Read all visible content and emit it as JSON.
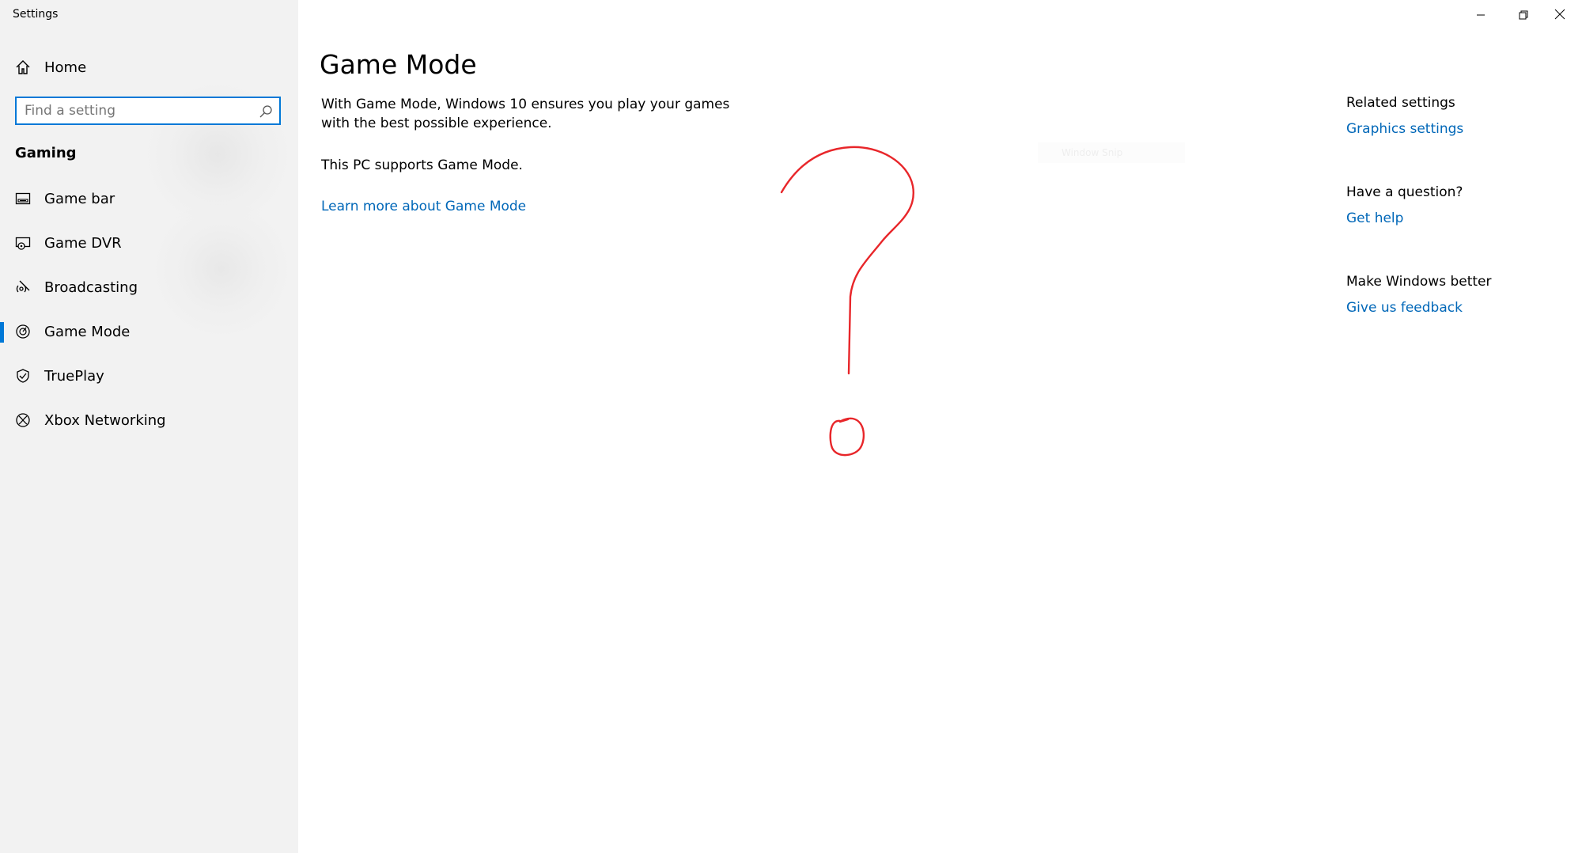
{
  "window": {
    "title": "Settings",
    "minimize_icon": "minimize-icon",
    "restore_icon": "restore-icon",
    "close_icon": "close-icon"
  },
  "sidebar": {
    "home_label": "Home",
    "home_icon": "home-icon",
    "search": {
      "placeholder": "Find a setting",
      "value": "",
      "icon": "search-icon"
    },
    "section_heading": "Gaming",
    "items": [
      {
        "label": "Game bar",
        "icon": "game-bar-icon",
        "selected": false
      },
      {
        "label": "Game DVR",
        "icon": "game-dvr-icon",
        "selected": false
      },
      {
        "label": "Broadcasting",
        "icon": "broadcasting-icon",
        "selected": false
      },
      {
        "label": "Game Mode",
        "icon": "game-mode-icon",
        "selected": true
      },
      {
        "label": "TruePlay",
        "icon": "trueplay-icon",
        "selected": false
      },
      {
        "label": "Xbox Networking",
        "icon": "xbox-icon",
        "selected": false
      }
    ]
  },
  "main": {
    "title": "Game Mode",
    "description": "With Game Mode, Windows 10 ensures you play your games with the best possible experience.",
    "status": "This PC supports Game Mode.",
    "learn_more": "Learn more about Game Mode",
    "faint_tooltip": "Window Snip"
  },
  "related": {
    "related_heading": "Related settings",
    "graphics_link": "Graphics settings",
    "question_heading": "Have a question?",
    "help_link": "Get help",
    "feedback_heading": "Make Windows better",
    "feedback_link": "Give us feedback"
  },
  "annotation": {
    "type": "hand-drawn question mark",
    "color": "#e8262a"
  },
  "colors": {
    "accent": "#0078d7",
    "link": "#0067b8",
    "sidebar_bg": "#f2f2f2"
  }
}
